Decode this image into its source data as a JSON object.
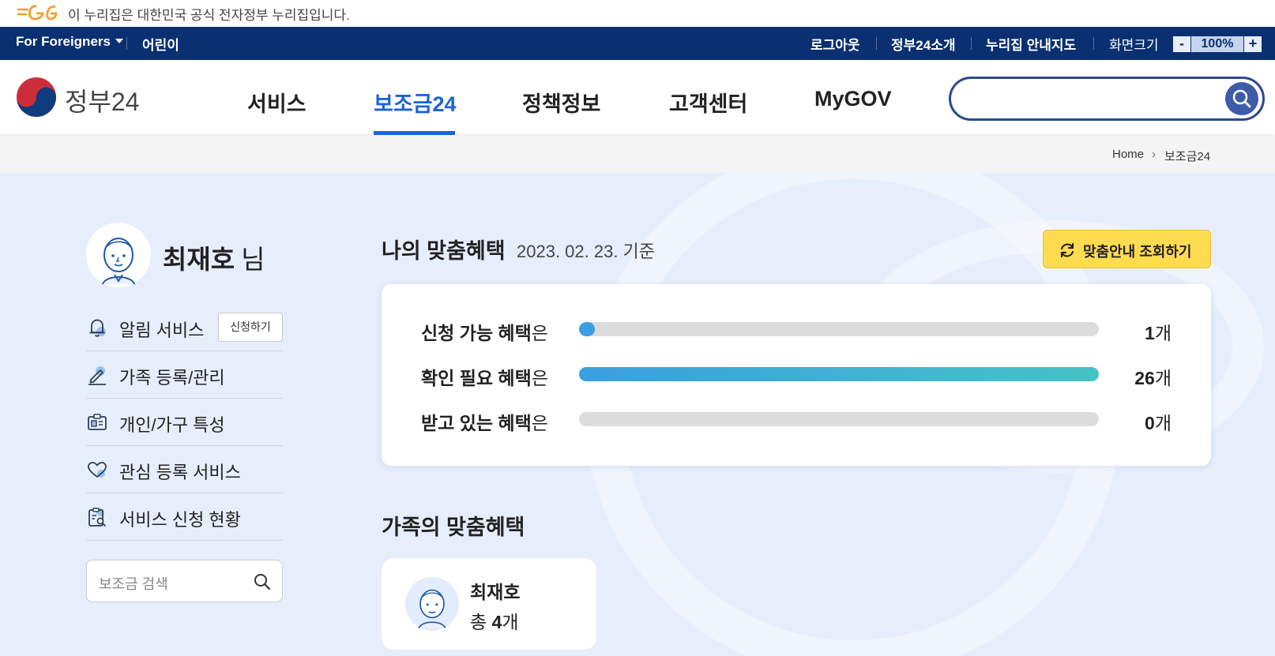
{
  "gov_banner": {
    "logo_text": "eG",
    "text": "이 누리집은 대한민국 공식 전자정부 누리집입니다."
  },
  "util_bar": {
    "foreigners": "For Foreigners",
    "kids": "어린이",
    "logout": "로그아웃",
    "about": "정부24소개",
    "sitemap": "누리집 안내지도",
    "zoom_label": "화면크기",
    "zoom_minus": "-",
    "zoom_value": "100%",
    "zoom_plus": "+"
  },
  "header": {
    "logo_text": "정부24",
    "nav": [
      {
        "label": "서비스"
      },
      {
        "label": "보조금24",
        "active": true
      },
      {
        "label": "정책정보"
      },
      {
        "label": "고객센터"
      },
      {
        "label": "MyGOV"
      }
    ],
    "search_value": ""
  },
  "breadcrumb": {
    "home": "Home",
    "separator": "›",
    "current": "보조금24"
  },
  "sidebar": {
    "user_name": "최재호",
    "honorific": "님",
    "menu": [
      {
        "label": "알림 서비스",
        "icon": "bell-icon",
        "button": "신청하기"
      },
      {
        "label": "가족 등록/관리",
        "icon": "pencil-icon"
      },
      {
        "label": "개인/가구 특성",
        "icon": "id-card-icon"
      },
      {
        "label": "관심 등록 서비스",
        "icon": "heart-icon"
      },
      {
        "label": "서비스 신청 현황",
        "icon": "clipboard-search-icon"
      }
    ],
    "search_placeholder": "보조금 검색"
  },
  "benefits": {
    "title": "나의 맞춤혜택",
    "date": "2023. 02. 23. 기준",
    "refresh_button": "맞춤안내 조회하기",
    "rows": [
      {
        "label_bold": "신청 가능 혜택",
        "label_suffix": "은",
        "count": "1",
        "unit": "개",
        "fill_fraction": 0.03
      },
      {
        "label_bold": "확인 필요 혜택",
        "label_suffix": "은",
        "count": "26",
        "unit": "개",
        "fill_fraction": 1.0
      },
      {
        "label_bold": "받고 있는 혜택",
        "label_suffix": "은",
        "count": "0",
        "unit": "개",
        "fill_fraction": 0.0
      }
    ],
    "colors": {
      "primary_fill": "#3a9fe0",
      "secondary_fill": "#46c3c6",
      "track": "#dcdcdc"
    }
  },
  "family": {
    "title": "가족의 맞춤혜택",
    "members": [
      {
        "name": "최재호",
        "total_prefix": "총",
        "total_count": "4",
        "total_unit": "개"
      }
    ]
  },
  "colors": {
    "util_bar": "#0a3071",
    "accent": "#1c64d8",
    "main_bg": "#e6eefc",
    "refresh_button": "#ffdc4f"
  }
}
